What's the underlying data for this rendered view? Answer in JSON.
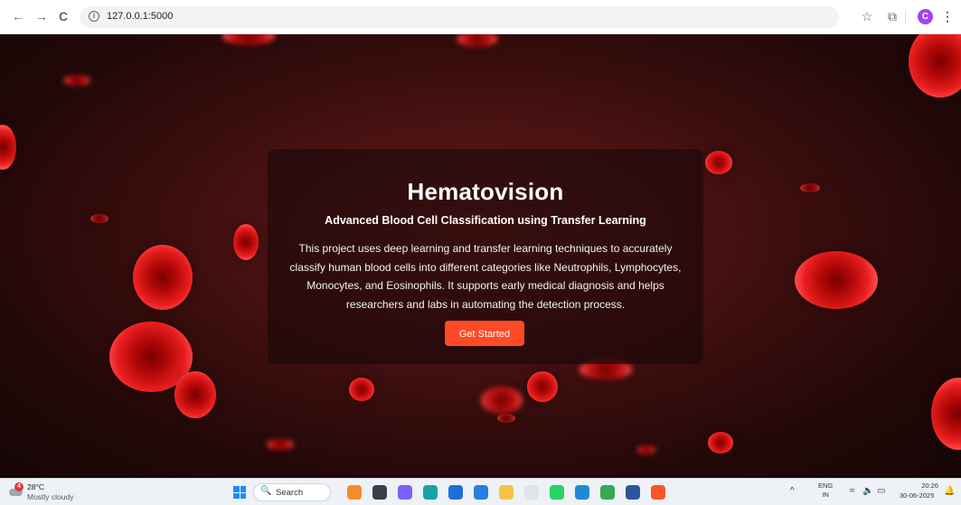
{
  "browser": {
    "url": "127.0.0.1:5000",
    "profile_initial": "C",
    "nav_back_glyph": "←",
    "nav_forward_glyph": "→",
    "reload_glyph": "C",
    "info_glyph": "i",
    "bookmark_glyph": "☆",
    "extensions_glyph": "⧉",
    "menu_glyph": "⋮"
  },
  "hero": {
    "title": "Hematovision",
    "subtitle": "Advanced Blood Cell Classification using Transfer Learning",
    "description": "This project uses deep learning and transfer learning techniques to accurately classify human blood cells into different categories like Neutrophils, Lymphocytes, Monocytes, and Eosinophils. It supports early medical diagnosis and helps researchers and labs in automating the detection process.",
    "cta_label": "Get Started",
    "cta_color": "#ff4a26",
    "background_theme": "red blood cells"
  },
  "taskbar": {
    "weather": {
      "temp": "28°C",
      "condition": "Mostly cloudy",
      "badge": "4"
    },
    "search_placeholder": "Search",
    "search_glyph": "🔍",
    "tray": {
      "chevron": "^",
      "lang_line1": "ENG",
      "lang_line2": "IN",
      "wifi_glyph": "≈",
      "volume_glyph": "🔈",
      "battery_glyph": "▭",
      "time": "20:26",
      "date": "30-06-2025",
      "bell_glyph": "🔔"
    },
    "apps": [
      {
        "name": "widgets-icon",
        "color": "#f28b30"
      },
      {
        "name": "task-view-icon",
        "color": "#3a3f4b"
      },
      {
        "name": "copilot-icon",
        "color": "#7b61ff"
      },
      {
        "name": "edge-icon",
        "color": "#1aa1a6"
      },
      {
        "name": "calculator-icon",
        "color": "#1e6fd9"
      },
      {
        "name": "mail-icon",
        "color": "#2a7de1"
      },
      {
        "name": "file-explorer-icon",
        "color": "#f5c542"
      },
      {
        "name": "notepad-icon",
        "color": "#dfe3ea"
      },
      {
        "name": "whatsapp-icon",
        "color": "#25d366"
      },
      {
        "name": "vscode-icon",
        "color": "#1f8ad2"
      },
      {
        "name": "chrome-icon",
        "color": "#34a853"
      },
      {
        "name": "word-icon",
        "color": "#2b579a"
      },
      {
        "name": "brave-icon",
        "color": "#fb542b"
      }
    ]
  }
}
